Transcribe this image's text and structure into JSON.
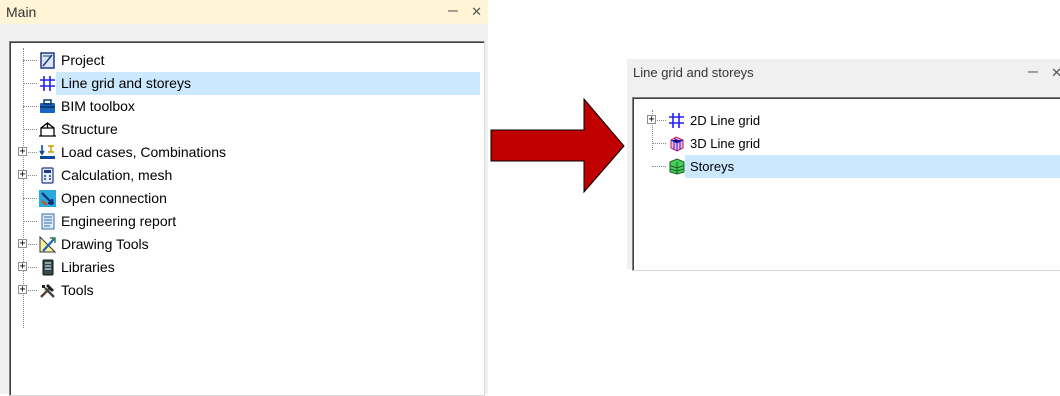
{
  "main_panel": {
    "title": "Main",
    "pin_glyph": "ㄧ",
    "close_glyph": "✕",
    "items": [
      {
        "label": "Project",
        "icon": "project-icon",
        "expandable": false,
        "selected": false
      },
      {
        "label": "Line grid and storeys",
        "icon": "line-grid-icon",
        "expandable": false,
        "selected": true
      },
      {
        "label": "BIM toolbox",
        "icon": "bim-toolbox-icon",
        "expandable": false,
        "selected": false
      },
      {
        "label": "Structure",
        "icon": "structure-icon",
        "expandable": false,
        "selected": false
      },
      {
        "label": "Load cases, Combinations",
        "icon": "load-cases-icon",
        "expandable": true,
        "selected": false
      },
      {
        "label": "Calculation, mesh",
        "icon": "calculator-icon",
        "expandable": true,
        "selected": false
      },
      {
        "label": "Open connection",
        "icon": "open-connection-icon",
        "expandable": false,
        "selected": false
      },
      {
        "label": "Engineering report",
        "icon": "report-icon",
        "expandable": false,
        "selected": false
      },
      {
        "label": "Drawing Tools",
        "icon": "drawing-tools-icon",
        "expandable": true,
        "selected": false
      },
      {
        "label": "Libraries",
        "icon": "libraries-icon",
        "expandable": true,
        "selected": false
      },
      {
        "label": "Tools",
        "icon": "tools-icon",
        "expandable": true,
        "selected": false
      }
    ]
  },
  "grid_panel": {
    "title": "Line grid and storeys",
    "pin_glyph": "ㄧ",
    "close_glyph": "✕",
    "items": [
      {
        "label": "2D Line grid",
        "icon": "2d-line-grid-icon",
        "expandable": true,
        "selected": false
      },
      {
        "label": "3D Line grid",
        "icon": "3d-line-grid-icon",
        "expandable": false,
        "selected": false
      },
      {
        "label": "Storeys",
        "icon": "storeys-icon",
        "expandable": false,
        "selected": true
      }
    ]
  },
  "colors": {
    "header_bg": "#fff4d6",
    "selection": "#cce8ff",
    "arrow_fill": "#c00000",
    "arrow_stroke": "#000000"
  }
}
